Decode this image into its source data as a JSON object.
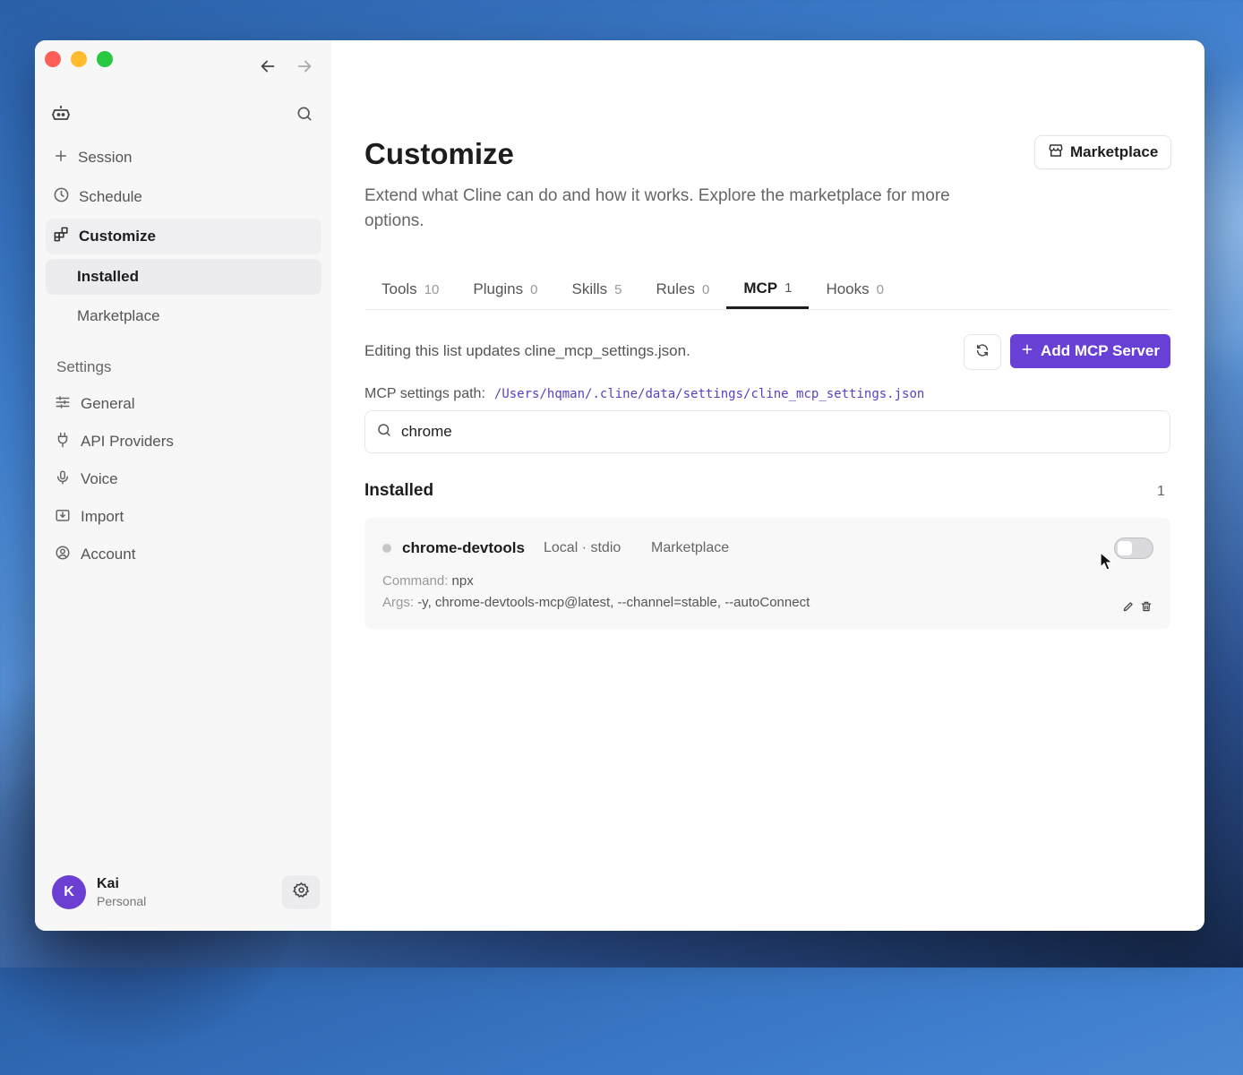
{
  "sidebar": {
    "nav": [
      {
        "label": "Session",
        "icon": "plus-icon"
      },
      {
        "label": "Schedule",
        "icon": "clock-icon"
      },
      {
        "label": "Customize",
        "icon": "blocks-icon"
      }
    ],
    "sub": [
      {
        "label": "Installed"
      },
      {
        "label": "Marketplace"
      }
    ],
    "settings_label": "Settings",
    "settings": [
      {
        "label": "General",
        "icon": "sliders-icon"
      },
      {
        "label": "API Providers",
        "icon": "plug-icon"
      },
      {
        "label": "Voice",
        "icon": "mic-icon"
      },
      {
        "label": "Import",
        "icon": "import-icon"
      },
      {
        "label": "Account",
        "icon": "account-icon"
      }
    ],
    "user": {
      "initial": "K",
      "name": "Kai",
      "plan": "Personal"
    }
  },
  "main": {
    "title": "Customize",
    "description": "Extend what Cline can do and how it works. Explore the marketplace for more options.",
    "marketplace_button": "Marketplace",
    "tabs": [
      {
        "label": "Tools",
        "count": "10"
      },
      {
        "label": "Plugins",
        "count": "0"
      },
      {
        "label": "Skills",
        "count": "5"
      },
      {
        "label": "Rules",
        "count": "0"
      },
      {
        "label": "MCP",
        "count": "1"
      },
      {
        "label": "Hooks",
        "count": "0"
      }
    ],
    "active_tab": "MCP",
    "edit_note": "Editing this list updates cline_mcp_settings.json.",
    "add_button": "Add MCP Server",
    "path_label": "MCP settings path:",
    "path_value": "/Users/hqman/.cline/data/settings/cline_mcp_settings.json",
    "search_value": "chrome",
    "installed_heading": "Installed",
    "installed_count": "1",
    "server": {
      "name": "chrome-devtools",
      "meta": "Local · stdio",
      "source": "Marketplace",
      "command_label": "Command:",
      "command_value": "npx",
      "args_label": "Args:",
      "args_value": "-y, chrome-devtools-mcp@latest, --channel=stable, --autoConnect",
      "enabled": false
    }
  },
  "colors": {
    "accent": "#6940d6",
    "avatar": "#6a3fd1"
  }
}
